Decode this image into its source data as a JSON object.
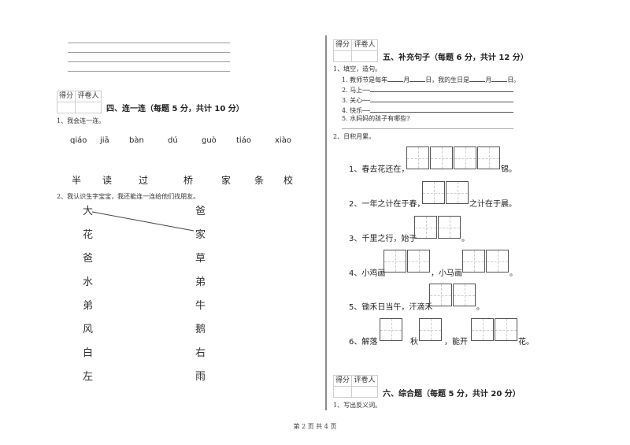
{
  "left": {
    "answer_lines": 4,
    "section4": {
      "score_box": {
        "score_label": "得分",
        "grader_label": "评卷人"
      },
      "title": "四、连一连（每题 5 分，共计 10 分）",
      "q1": {
        "prompt": "1、我会连一连。",
        "pinyin": [
          "qiáo",
          "jiā",
          "bàn",
          "dú",
          "guò",
          "tiáo",
          "xiào"
        ],
        "hanzi": [
          "半",
          "读",
          "过",
          "桥",
          "家",
          "条",
          "校"
        ]
      },
      "q2": {
        "prompt": "2、我认识生字宝宝，我还能连一连给他们找朋友。",
        "left_column": [
          "大",
          "花",
          "爸",
          "水",
          "弟",
          "风",
          "白",
          "左"
        ],
        "right_column": [
          "爸",
          "家",
          "草",
          "弟",
          "牛",
          "鹅",
          "右",
          "雨"
        ],
        "example_connection": {
          "from": "大",
          "to": "家"
        }
      }
    }
  },
  "right": {
    "section5": {
      "score_box": {
        "score_label": "得分",
        "grader_label": "评卷人"
      },
      "title": "五、补充句子（每题 6 分，共计 12 分）",
      "q1": {
        "prompt": "1、填空，造句。",
        "items": [
          {
            "pre": "1. 教师节是每年",
            "mid1": "月",
            "mid2": "日，我的生日是",
            "mid3": "月",
            "end": "日。"
          },
          {
            "text": "2. 马上──"
          },
          {
            "text": "3. 关心──"
          },
          {
            "text": "4. 快乐──"
          },
          {
            "text": "5. 水妈妈的孩子有哪些?"
          }
        ]
      },
      "q2": {
        "prompt": "2、日积月累。",
        "items": [
          {
            "parts": [
              "1、春去花还在，",
              "锦。"
            ]
          },
          {
            "parts": [
              "2、一年之计在于春，",
              "之计在于晨。"
            ]
          },
          {
            "parts": [
              "3、千里之行，始于",
              "。"
            ]
          },
          {
            "parts": [
              "4、小鸡画",
              "，小马画",
              "。"
            ]
          },
          {
            "parts": [
              "5、锄禾日当午，汗滴禾",
              "。"
            ]
          },
          {
            "parts": [
              "6、解落",
              "秋",
              "，能开",
              "花。"
            ]
          }
        ]
      }
    },
    "section6": {
      "score_box": {
        "score_label": "得分",
        "grader_label": "评卷人"
      },
      "title": "六、综合题（每题 5 分，共计 20 分）",
      "q1": {
        "prompt": "1、写出反义词。"
      }
    }
  },
  "footer": {
    "page_info": "第 2 页 共 4 页"
  }
}
